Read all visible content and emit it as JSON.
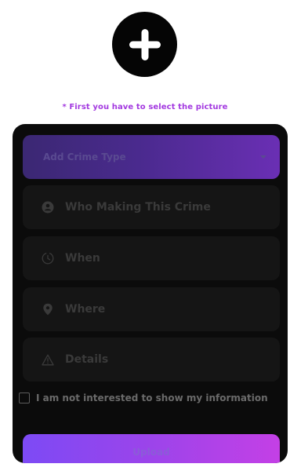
{
  "photo": {
    "icon": "plus-icon"
  },
  "hint": "* First you have to select the picture",
  "form": {
    "crime_type": {
      "placeholder": "Add Crime Type",
      "icon": "chevron-down-icon"
    },
    "fields": [
      {
        "placeholder": "Who Making This Crime",
        "icon": "user-icon"
      },
      {
        "placeholder": "When",
        "icon": "clock-icon"
      },
      {
        "placeholder": "Where",
        "icon": "location-pin-icon"
      },
      {
        "placeholder": "Details",
        "icon": "warning-icon"
      }
    ],
    "consent": {
      "label": "I am not interested to show my information",
      "checked": false
    },
    "upload_label": "Upload"
  },
  "colors": {
    "accent": "#a339e0",
    "card": "#0b0b0b",
    "field": "#151515",
    "gradient_start": "#7d4af5",
    "gradient_end": "#c440e6"
  }
}
